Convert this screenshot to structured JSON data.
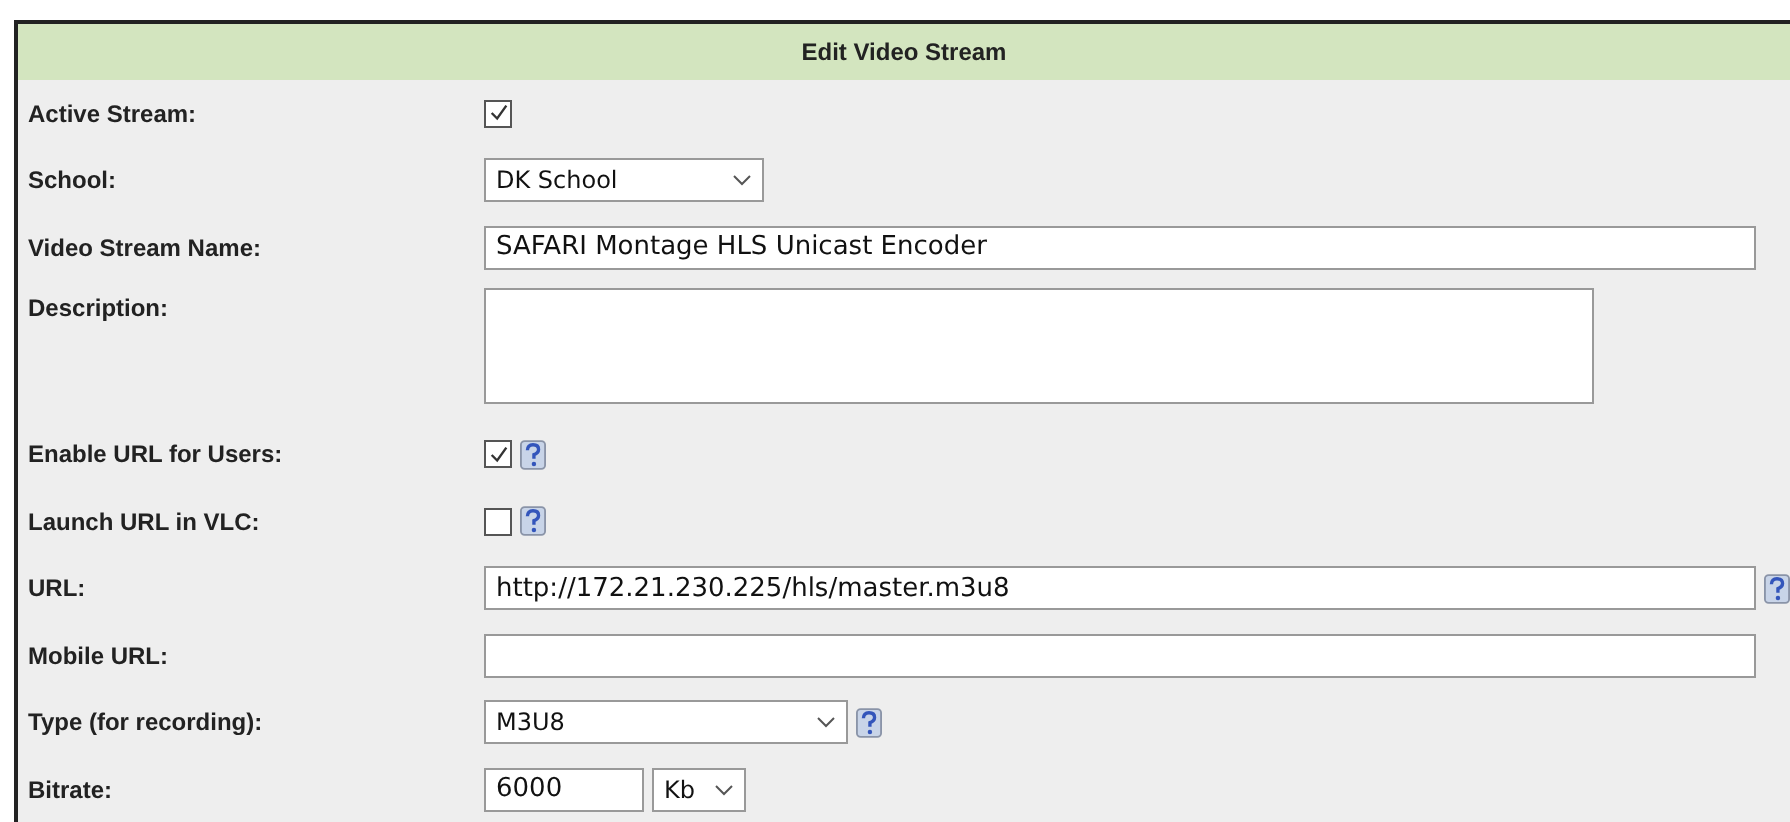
{
  "title": "Edit Video Stream",
  "fields": [
    {
      "kind": "checkbox",
      "label": "Active Stream:",
      "checked": true,
      "help": false
    },
    {
      "kind": "select",
      "label": "School:",
      "value": "DK School",
      "help": false
    },
    {
      "kind": "text",
      "label": "Video Stream Name:",
      "value": "SAFARI Montage HLS Unicast Encoder",
      "help": false
    },
    {
      "kind": "textarea",
      "label": "Description:",
      "help": false
    },
    {
      "kind": "checkbox",
      "label": "Enable URL for Users:",
      "checked": true,
      "help": true
    },
    {
      "kind": "checkbox",
      "label": "Launch URL in VLC:",
      "checked": false,
      "help": true
    },
    {
      "kind": "text",
      "label": "URL:",
      "value": "http://172.21.230.225/hls/master.m3u8",
      "help": true
    },
    {
      "kind": "text",
      "label": "Mobile URL:",
      "help": false
    },
    {
      "kind": "select",
      "label": "Type (for recording):",
      "value": "M3U8",
      "help": true
    },
    {
      "kind": "bitrate",
      "label": "Bitrate:",
      "value": "6000",
      "unit": "Kb",
      "help": false
    }
  ]
}
